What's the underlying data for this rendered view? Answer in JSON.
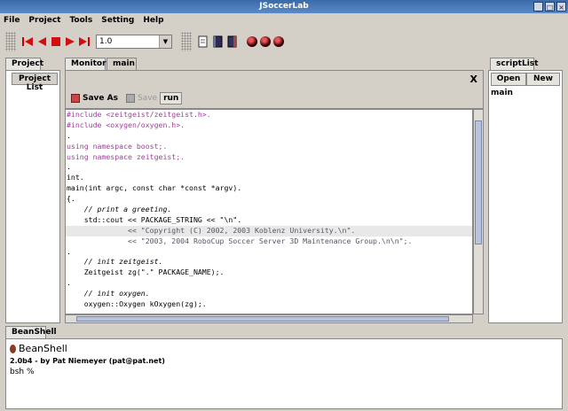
{
  "window": {
    "title": "JSoccerLab",
    "controls": [
      "_",
      "□",
      "×"
    ]
  },
  "menu": [
    "File",
    "Project",
    "Tools",
    "Setting",
    "Help"
  ],
  "toolbar": {
    "speed_value": "1.0"
  },
  "left_panel": {
    "tab": "Project",
    "sub_tab": "Project List"
  },
  "editor": {
    "tabs": [
      "Monitor",
      "main"
    ],
    "close_symbol": "X",
    "save_as_label": "Save As",
    "save_label": "Save",
    "run_label": "run",
    "lines": [
      "#include <zeitgeist/zeitgeist.h>.",
      "#include <oxygen/oxygen.h>.",
      ".",
      "using namespace boost;.",
      "using namespace zeitgeist;.",
      ".",
      "int.",
      "main(int argc, const char *const *argv).",
      "{.",
      "    // print a greeting.",
      "    std::cout << PACKAGE_STRING << \"\\n\".",
      "              << \"Copyright (C) 2002, 2003 Koblenz University.\\n\".",
      "              << \"2003, 2004 RoboCup Soccer Server 3D Maintenance Group.\\n\\n\";.",
      ".",
      "    // init zeitgeist.",
      "    Zeitgeist zg(\".\" PACKAGE_NAME);.",
      ".",
      "    // init oxygen.",
      "    oxygen::Oxygen kOxygen(zg);."
    ]
  },
  "right_panel": {
    "tab": "scriptList",
    "open_label": "Open",
    "new_label": "New",
    "items": [
      "main"
    ]
  },
  "beanshell": {
    "tab": "BeanShell",
    "heading": "BeanShell",
    "version": "2.0b4 - by Pat Niemeyer (pat@pat.net)",
    "prompt": "bsh %"
  }
}
